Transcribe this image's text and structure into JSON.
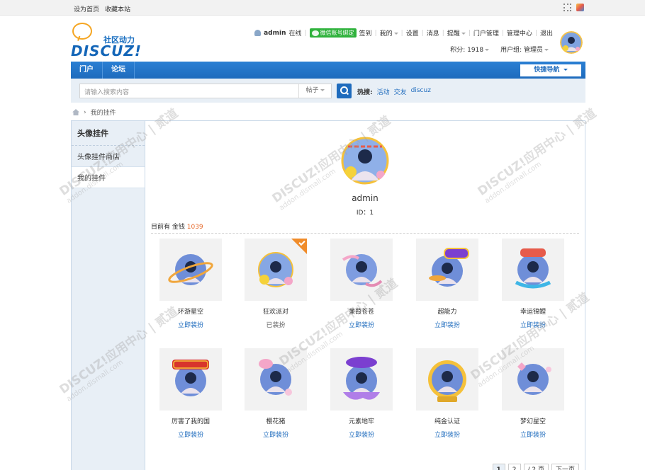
{
  "topbar": {
    "set_home": "设为首页",
    "favorite": "收藏本站"
  },
  "header": {
    "logo_tag": "社区动力",
    "logo_word": "DISCUZ!",
    "username": "admin",
    "online": "在线",
    "wechat_bind": "微信账号绑定",
    "links": [
      "签到",
      "我的",
      "设置",
      "消息",
      "提醒",
      "门户管理",
      "管理中心",
      "退出"
    ],
    "credits": "积分: 1918",
    "usergroup": "用户组: 管理员"
  },
  "nav": {
    "items": [
      "门户",
      "论坛"
    ],
    "quick_nav": "快捷导航"
  },
  "search": {
    "placeholder": "请输入搜索内容",
    "type": "帖子",
    "hot_label": "热搜:",
    "hot_tags": [
      "活动",
      "交友",
      "discuz"
    ]
  },
  "breadcrumb": {
    "current": "我的挂件"
  },
  "sidebar": {
    "title": "头像挂件",
    "items": [
      "头像挂件商店",
      "我的挂件"
    ]
  },
  "profile": {
    "name": "admin",
    "id_text": "ID：1"
  },
  "money": {
    "label": "目前有 金钱",
    "value": "1039"
  },
  "pendants": [
    {
      "name": "环游星空",
      "action": "立即装扮",
      "equipped": false
    },
    {
      "name": "狂欢派对",
      "action": "已装扮",
      "equipped": true
    },
    {
      "name": "蒹葭苍苍",
      "action": "立即装扮",
      "equipped": false
    },
    {
      "name": "超能力",
      "action": "立即装扮",
      "equipped": false
    },
    {
      "name": "幸运锦鲤",
      "action": "立即装扮",
      "equipped": false
    },
    {
      "name": "厉害了我的国",
      "action": "立即装扮",
      "equipped": false
    },
    {
      "name": "樱花猪",
      "action": "立即装扮",
      "equipped": false
    },
    {
      "name": "元素地牢",
      "action": "立即装扮",
      "equipped": false
    },
    {
      "name": "纯金认证",
      "action": "立即装扮",
      "equipped": false
    },
    {
      "name": "梦幻星空",
      "action": "立即装扮",
      "equipped": false
    }
  ],
  "pager": {
    "pages": [
      "1",
      "2"
    ],
    "total": "/ 2 页",
    "next": "下一页"
  },
  "watermark": {
    "line1": "DISCUZ!应用中心 | 贰道",
    "line2": "addon.dismall.com"
  },
  "colors": {
    "brand": "#1e6bbd",
    "accent": "#e66a2c",
    "wechat": "#2fb23c"
  }
}
